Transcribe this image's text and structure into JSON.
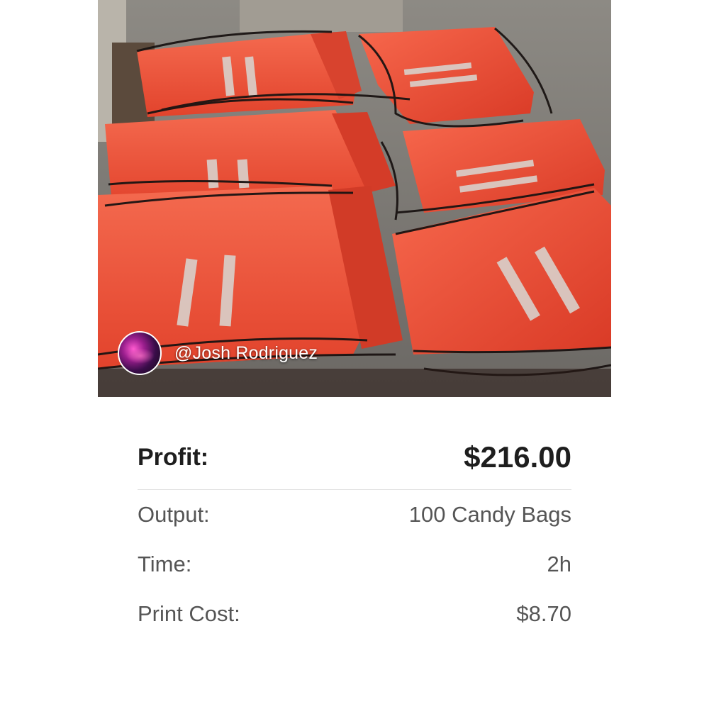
{
  "post": {
    "author_handle": "@Josh Rodriguez",
    "image_subject": "stacks of orange drawstring candy bags"
  },
  "summary": {
    "profit_label": "Profit:",
    "profit_value": "$216.00",
    "details": [
      {
        "label": "Output:",
        "value": "100 Candy Bags"
      },
      {
        "label": "Time:",
        "value": "2h"
      },
      {
        "label": "Print Cost:",
        "value": "$8.70"
      }
    ]
  },
  "colors": {
    "bag_orange": "#f0503a",
    "drawstring": "#1a1412",
    "text_primary": "#1e1e1e",
    "text_secondary": "#555555",
    "divider": "#e2e2e2"
  }
}
